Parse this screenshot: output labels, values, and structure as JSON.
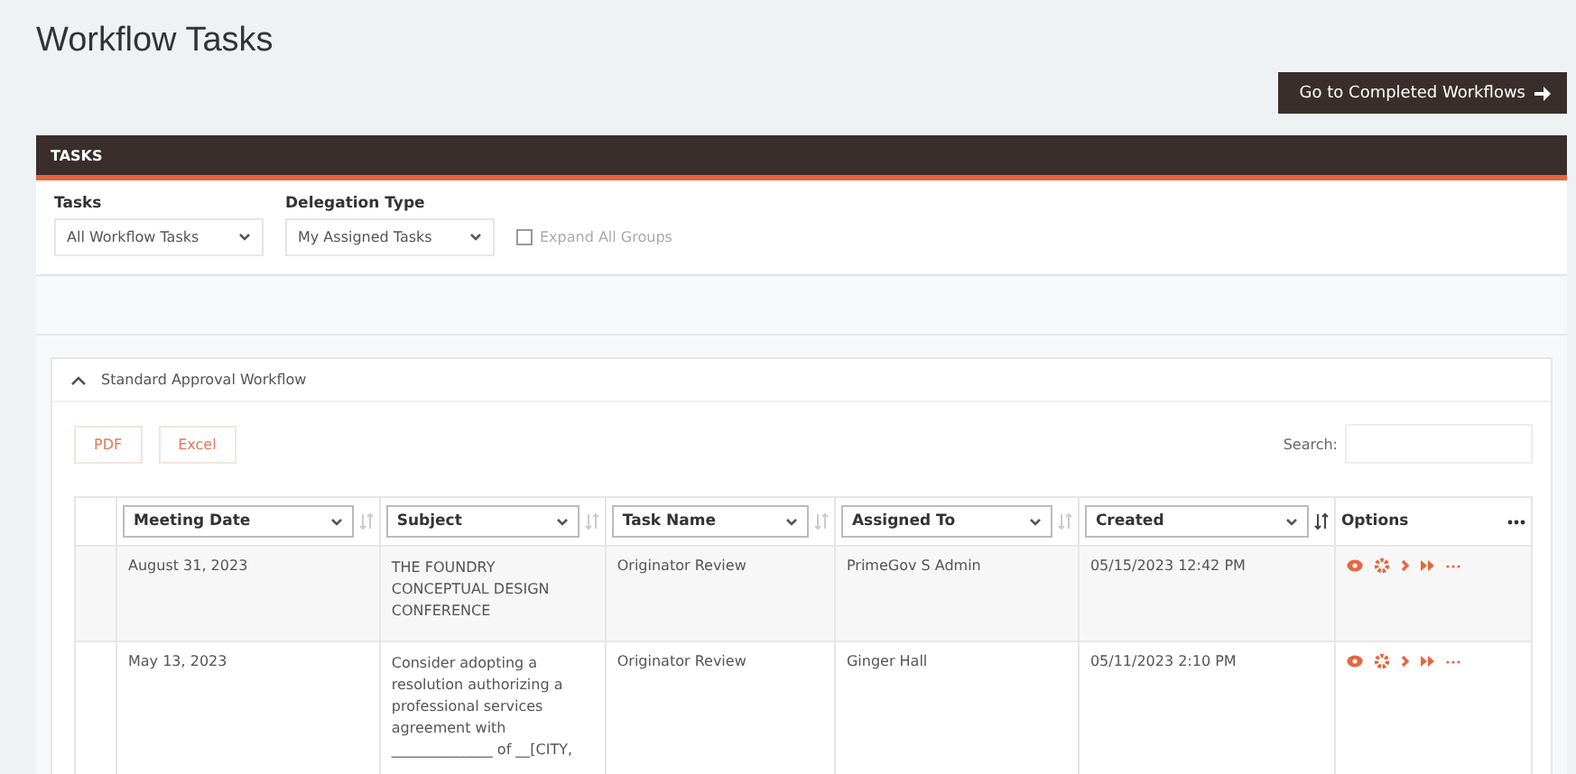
{
  "page": {
    "title": "Workflow Tasks",
    "action_button": "Go to Completed Workflows"
  },
  "panel": {
    "title": "TASKS",
    "filters": [
      {
        "label": "Tasks",
        "value": "All Workflow Tasks"
      },
      {
        "label": "Delegation Type",
        "value": "My Assigned Tasks"
      }
    ],
    "expand_all": {
      "label": "Expand All Groups",
      "checked": false
    }
  },
  "group": {
    "title": "Standard Approval Workflow",
    "expanded": true,
    "export_buttons": [
      "PDF",
      "Excel"
    ],
    "search": {
      "label": "Search:"
    },
    "columns": [
      {
        "label": "Meeting Date",
        "sorted": false
      },
      {
        "label": "Subject",
        "sorted": false
      },
      {
        "label": "Task Name",
        "sorted": false
      },
      {
        "label": "Assigned To",
        "sorted": false
      },
      {
        "label": "Created",
        "sorted": true
      }
    ],
    "options_column": {
      "label": "Options"
    },
    "rows": [
      {
        "cells": [
          "August 31, 2023",
          "THE FOUNDRY CONCEPTUAL DESIGN CONFERENCE",
          "Originator Review",
          "PrimeGov S Admin",
          "05/15/2023 12:42 PM"
        ]
      },
      {
        "cells": [
          "May 13, 2023",
          "Consider adopting a resolution authorizing a professional services agreement with ______________ of __[CITY,",
          "Originator Review",
          "Ginger Hall",
          "05/11/2023 2:10 PM"
        ]
      }
    ]
  }
}
